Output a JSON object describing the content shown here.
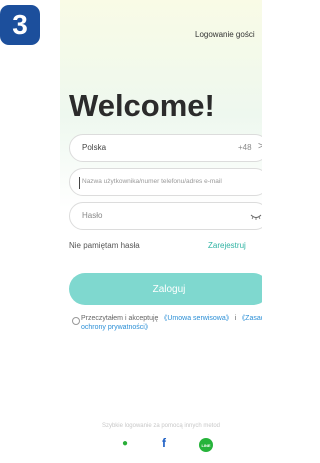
{
  "step": "3",
  "header": {
    "guest_login": "Logowanie gości"
  },
  "welcome": "Welcome!",
  "country_field": {
    "country": "Polska",
    "code": "+48",
    "chevron": ">"
  },
  "username_field": {
    "placeholder": "Nazwa użytkownika/numer telefonu/adres e-mail"
  },
  "password_field": {
    "placeholder": "Hasło",
    "eye_icon": "eye-hidden-icon"
  },
  "forgot_password": "Nie pamiętam hasła",
  "register": "Zarejestruj",
  "login_button": "Zaloguj",
  "agreement": {
    "prefix": "Przeczytałem i akceptuję ",
    "terms": "《Umowa serwisowa》",
    "sep": " i ",
    "privacy": "《Zasady ochrony prywatności》"
  },
  "other_login": "Szybkie logowanie za pomocą innych metod",
  "social": [
    {
      "name": "wechat-icon",
      "glyph": "●",
      "color": "#2aae39"
    },
    {
      "name": "facebook-icon",
      "glyph": "f",
      "color": "#1d5fc4"
    },
    {
      "name": "line-icon",
      "glyph": "LINE",
      "color": "#26b33a"
    }
  ]
}
